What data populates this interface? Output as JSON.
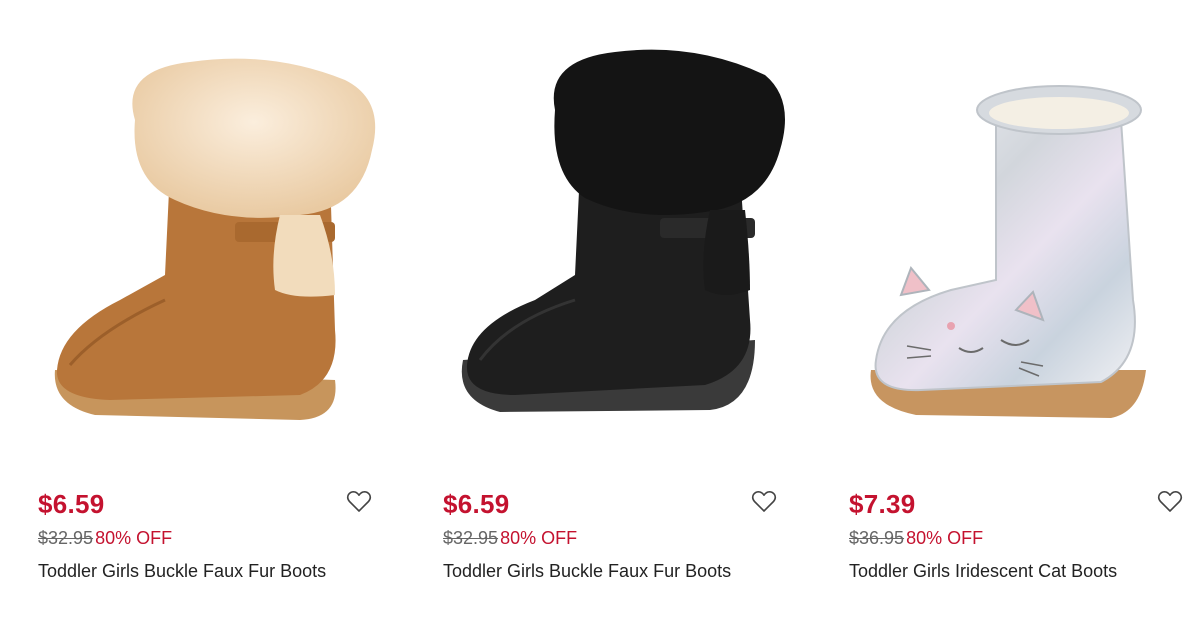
{
  "products": [
    {
      "sale_price": "$6.59",
      "original_price": "$32.95",
      "discount": "80% OFF",
      "title": "Toddler Girls Buckle Faux Fur Boots",
      "image": "tan-suede-faux-fur-boot",
      "colors": {
        "body": "#b8763a",
        "fur": "#f3dcc0",
        "sole": "#c7955c"
      }
    },
    {
      "sale_price": "$6.59",
      "original_price": "$32.95",
      "discount": "80% OFF",
      "title": "Toddler Girls Buckle Faux Fur Boots",
      "image": "black-suede-faux-fur-boot",
      "colors": {
        "body": "#1e1e1e",
        "fur": "#141414",
        "sole": "#3a3a3a"
      }
    },
    {
      "sale_price": "$7.39",
      "original_price": "$36.95",
      "discount": "80% OFF",
      "title": "Toddler Girls Iridescent Cat Boots",
      "image": "silver-iridescent-cat-boot",
      "colors": {
        "body": "#d9dde2",
        "fur": "#f4efe4",
        "sole": "#c79560"
      }
    }
  ],
  "icons": {
    "wishlist": "heart-outline-icon"
  },
  "theme": {
    "sale_color": "#c4122f",
    "text_color": "#222222"
  }
}
